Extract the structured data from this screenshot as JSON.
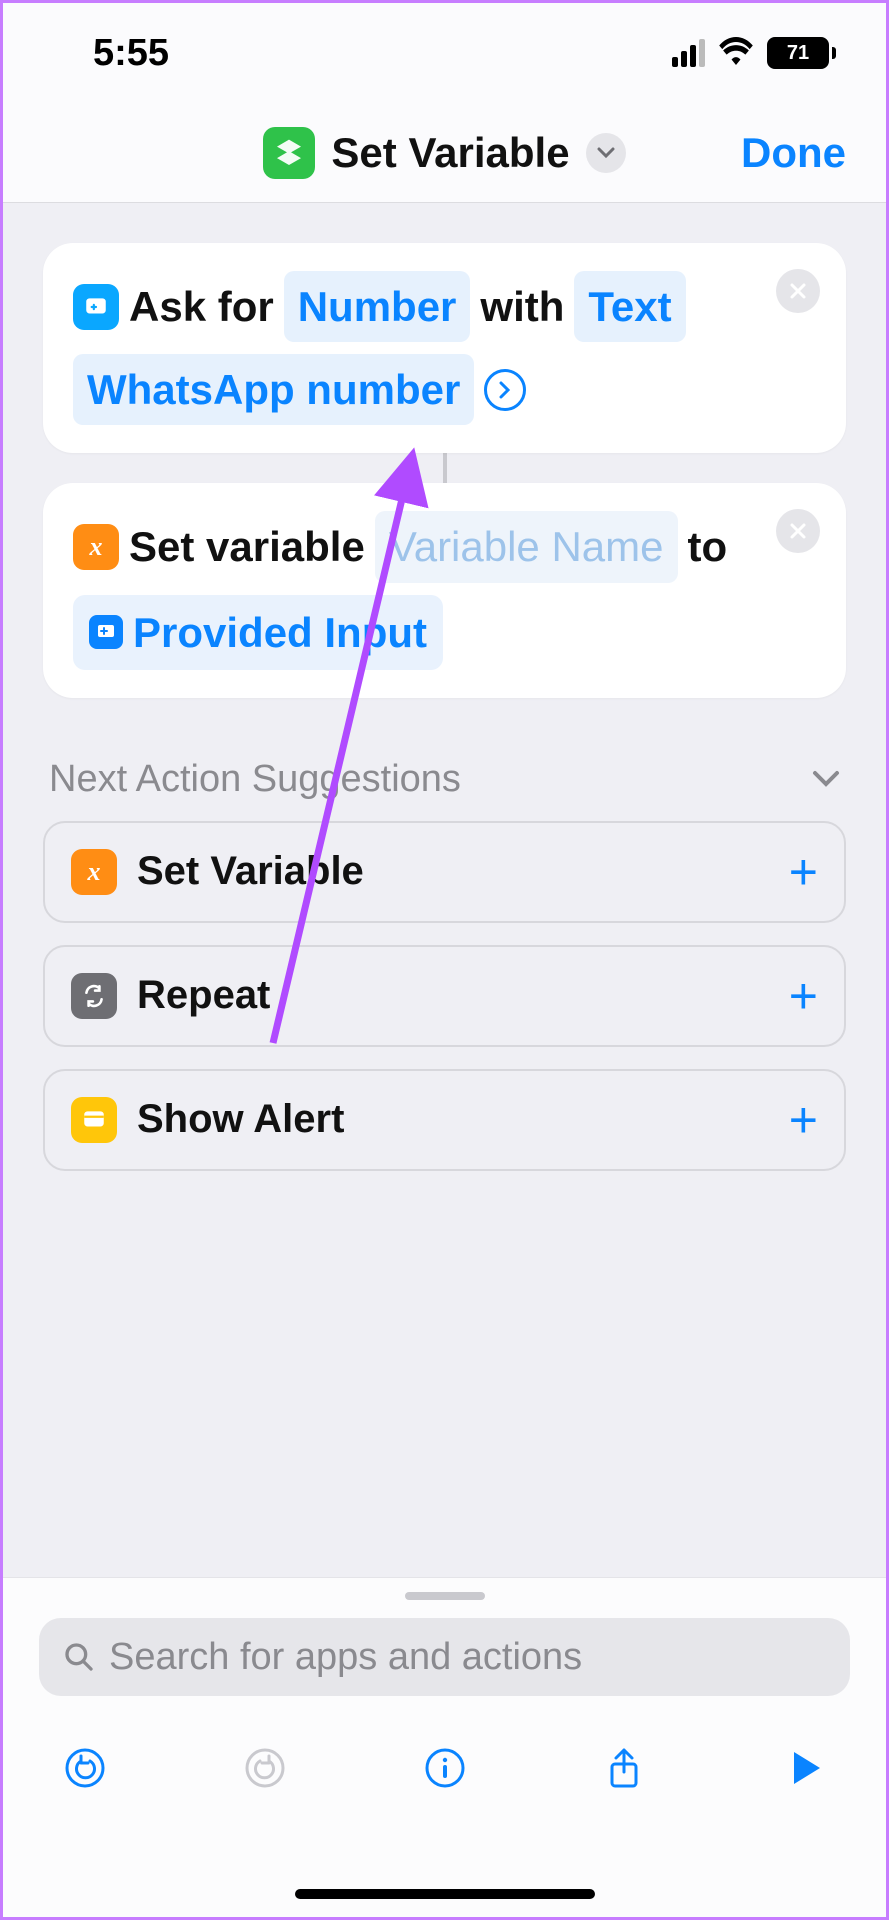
{
  "status": {
    "time": "5:55",
    "battery": "71"
  },
  "header": {
    "title": "Set Variable",
    "done": "Done"
  },
  "actions": {
    "ask": {
      "verb": "Ask for",
      "type": "Number",
      "with": "with",
      "prompt_type": "Text",
      "prompt_value": "WhatsApp number"
    },
    "setvar": {
      "verb": "Set variable",
      "var_placeholder": "Variable Name",
      "to": "to",
      "input": "Provided Input"
    }
  },
  "suggestions": {
    "heading": "Next Action Suggestions",
    "items": [
      {
        "label": "Set Variable",
        "icon": "var"
      },
      {
        "label": "Repeat",
        "icon": "repeat"
      },
      {
        "label": "Show Alert",
        "icon": "alert"
      }
    ]
  },
  "search": {
    "placeholder": "Search for apps and actions"
  }
}
